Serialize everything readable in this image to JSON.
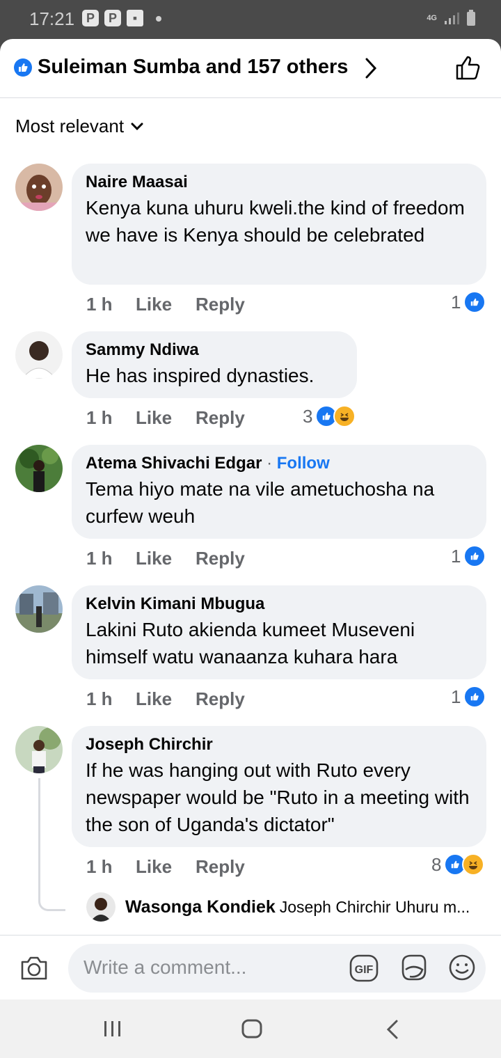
{
  "status": {
    "time": "17:21",
    "network": "4G"
  },
  "header": {
    "title": "Suleiman Sumba and 157 others"
  },
  "sort": {
    "label": "Most relevant"
  },
  "comments": [
    {
      "name": "Naire Maasai",
      "text": "Kenya kuna uhuru kweli.the kind of freedom we have is Kenya should be celebrated",
      "time": "1 h",
      "like": "Like",
      "reply": "Reply",
      "count": "1"
    },
    {
      "name": "Sammy Ndiwa",
      "text": "He has inspired dynasties.",
      "time": "1 h",
      "like": "Like",
      "reply": "Reply",
      "count": "3"
    },
    {
      "name": "Atema Shivachi Edgar",
      "follow_sep": "·",
      "follow": "Follow",
      "text": "Tema hiyo mate na vile ametuchosha na curfew weuh",
      "time": "1 h",
      "like": "Like",
      "reply": "Reply",
      "count": "1"
    },
    {
      "name": "Kelvin Kimani Mbugua",
      "text": "Lakini Ruto akienda kumeet Museveni himself watu wanaanza kuhara hara",
      "time": "1 h",
      "like": "Like",
      "reply": "Reply",
      "count": "1"
    },
    {
      "name": "Joseph Chirchir",
      "text": "If he was hanging out with Ruto every newspaper would be \"Ruto in a meeting with the son of Uganda's dictator\"",
      "time": "1 h",
      "like": "Like",
      "reply": "Reply",
      "count": "8"
    }
  ],
  "reply_preview": {
    "name": "Wasonga Kondiek",
    "text": "Joseph Chirchir Uhuru m..."
  },
  "composer": {
    "placeholder": "Write a comment..."
  },
  "colors": {
    "accent": "#1877f2",
    "bubble": "#f0f2f5",
    "meta": "#65676b"
  }
}
